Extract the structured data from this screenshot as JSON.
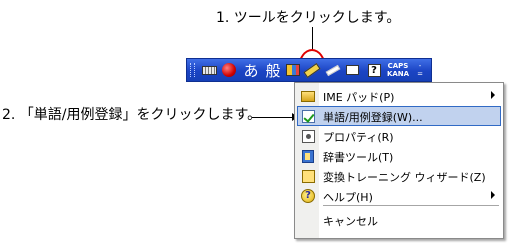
{
  "annotations": {
    "step1": "1. ツールをクリックします。",
    "step2": "2. 「単語/用例登録」をクリックします。"
  },
  "language_bar": {
    "input_mode": "あ",
    "conversion_mode": "般",
    "caps": "CAPS",
    "kana": "KANA",
    "help_glyph": "?",
    "minimize": "-",
    "restore": "=",
    "icons": [
      "keyboard-icon",
      "ime-ball-icon",
      "tools-icon",
      "ime-pad-icon",
      "handwriting-icon",
      "capture-icon",
      "help-icon"
    ]
  },
  "menu": {
    "items": [
      {
        "label": "IME パッド(P)",
        "icon": "ime-pad-icon",
        "submenu": true
      },
      {
        "label": "単語/用例登録(W)...",
        "icon": "word-register-icon",
        "submenu": false,
        "highlighted": true
      },
      {
        "label": "プロパティ(R)",
        "icon": "properties-icon",
        "submenu": false
      },
      {
        "label": "辞書ツール(T)",
        "icon": "dictionary-tool-icon",
        "submenu": false
      },
      {
        "label": "変換トレーニング ウィザード(Z)",
        "icon": "training-wizard-icon",
        "submenu": false
      },
      {
        "label": "ヘルプ(H)",
        "icon": "help-icon",
        "submenu": true
      },
      {
        "label": "キャンセル",
        "icon": "",
        "submenu": false
      }
    ]
  },
  "colors": {
    "bar": "#2a55d1",
    "highlight": "#c1d2ee",
    "annotation_circle": "#e00000"
  }
}
